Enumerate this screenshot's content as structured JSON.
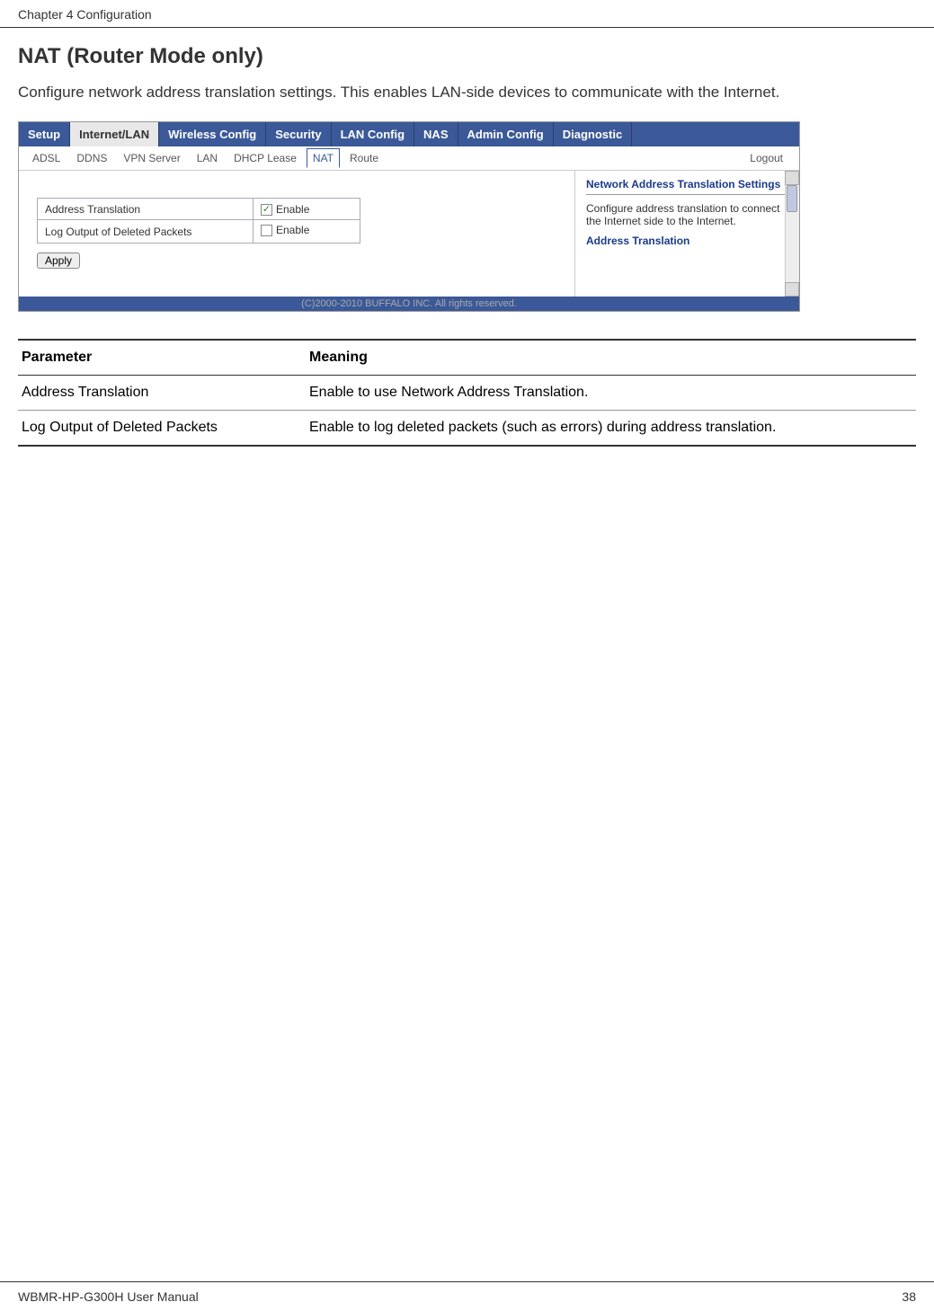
{
  "header": {
    "chapter": "Chapter 4  Configuration"
  },
  "section": {
    "title": "NAT (Router Mode only)",
    "intro": "Configure network address translation settings.  This enables LAN-side devices to communicate with the Internet."
  },
  "screenshot": {
    "main_tabs": {
      "setup": "Setup",
      "internet_lan": "Internet/LAN",
      "wireless": "Wireless Config",
      "security": "Security",
      "lan_config": "LAN Config",
      "nas": "NAS",
      "admin": "Admin Config",
      "diagnostic": "Diagnostic"
    },
    "sub_tabs": {
      "adsl": "ADSL",
      "ddns": "DDNS",
      "vpn": "VPN Server",
      "lan": "LAN",
      "dhcp": "DHCP Lease",
      "nat": "NAT",
      "route": "Route"
    },
    "logout": "Logout",
    "settings": {
      "row1_label": "Address Translation",
      "row1_enable": "Enable",
      "row2_label": "Log Output of Deleted Packets",
      "row2_enable": "Enable"
    },
    "apply": "Apply",
    "sidebar": {
      "title": "Network Address Translation Settings",
      "text": "Configure address translation to connect the Internet side to the Internet.",
      "subtitle": "Address Translation"
    },
    "footer": "(C)2000-2010 BUFFALO INC. All rights reserved."
  },
  "table": {
    "header_param": "Parameter",
    "header_meaning": "Meaning",
    "rows": [
      {
        "param": "Address Translation",
        "meaning": "Enable to use Network Address Translation."
      },
      {
        "param": "Log Output of Deleted Packets",
        "meaning": "Enable to log deleted packets (such as errors) during address translation."
      }
    ]
  },
  "footer": {
    "manual": "WBMR-HP-G300H User Manual",
    "page": "38"
  }
}
